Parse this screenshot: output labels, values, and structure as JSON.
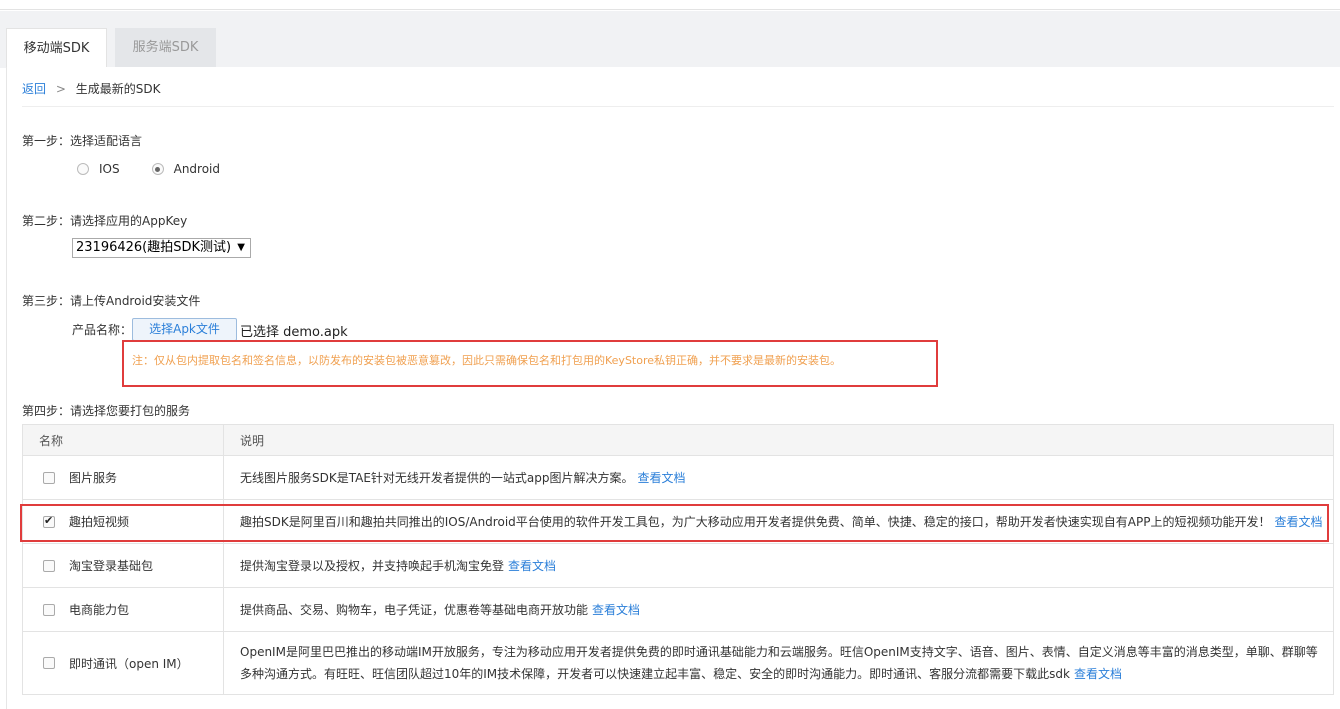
{
  "tabs": [
    {
      "label": "移动端SDK",
      "active": true
    },
    {
      "label": "服务端SDK",
      "active": false
    }
  ],
  "breadcrumb": {
    "back": "返回",
    "separator": ">",
    "current": "生成最新的SDK"
  },
  "step1": {
    "label": "第一步：选择适配语言",
    "options": [
      {
        "label": "IOS",
        "checked": false
      },
      {
        "label": "Android",
        "checked": true
      }
    ]
  },
  "step2": {
    "label": "第二步：请选择应用的AppKey",
    "selected": "23196426(趣拍SDK测试)",
    "caret": "▼"
  },
  "step3": {
    "label": "第三步：请上传Android安装文件",
    "product_label": "产品名称：",
    "upload_button": "选择Apk文件",
    "upload_status": "已选择 demo.apk",
    "note": "注：仅从包内提取包名和签名信息，以防发布的安装包被恶意篡改，因此只需确保包名和打包用的KeyStore私钥正确，并不要求是最新的安装包。"
  },
  "step4": {
    "label": "第四步：请选择您要打包的服务",
    "columns": [
      "名称",
      "说明"
    ],
    "rows": [
      {
        "name": "图片服务",
        "checked": false,
        "desc": "无线图片服务SDK是TAE针对无线开发者提供的一站式app图片解决方案。",
        "link": "查看文档"
      },
      {
        "name": "趣拍短视频",
        "checked": true,
        "desc": "趣拍SDK是阿里百川和趣拍共同推出的IOS/Android平台使用的软件开发工具包，为广大移动应用开发者提供免费、简单、快捷、稳定的接口，帮助开发者快速实现自有APP上的短视频功能开发！",
        "link": "查看文档"
      },
      {
        "name": "淘宝登录基础包",
        "checked": false,
        "desc": "提供淘宝登录以及授权，并支持唤起手机淘宝免登",
        "link": "查看文档"
      },
      {
        "name": "电商能力包",
        "checked": false,
        "desc": "提供商品、交易、购物车，电子凭证，优惠卷等基础电商开放功能",
        "link": "查看文档"
      },
      {
        "name": "即时通讯（open IM）",
        "checked": false,
        "desc": "OpenIM是阿里巴巴推出的移动端IM开放服务，专注为移动应用开发者提供免费的即时通讯基础能力和云端服务。旺信OpenIM支持文字、语音、图片、表情、自定义消息等丰富的消息类型，单聊、群聊等多种沟通方式。有旺旺、旺信团队超过10年的IM技术保障，开发者可以快速建立起丰富、稳定、安全的即时沟通能力。即时通讯、客服分流都需要下载此sdk",
        "link": "查看文档"
      }
    ]
  },
  "colors": {
    "accent": "#2b7fd9",
    "note": "#f0a050",
    "highlight": "#e03c3c"
  }
}
